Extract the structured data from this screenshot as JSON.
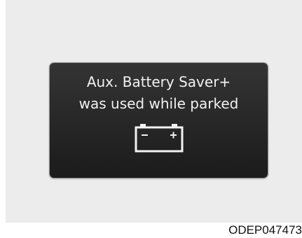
{
  "message": {
    "line1": "Aux. Battery Saver+",
    "line2": "was used while parked"
  },
  "icon": "battery-icon",
  "image_code": "ODEP047473",
  "colors": {
    "page_background": "#ececec",
    "message_background": "#232323",
    "message_text": "#f2f2f2",
    "icon": "#f2f2f2",
    "image_code": "#111111"
  }
}
